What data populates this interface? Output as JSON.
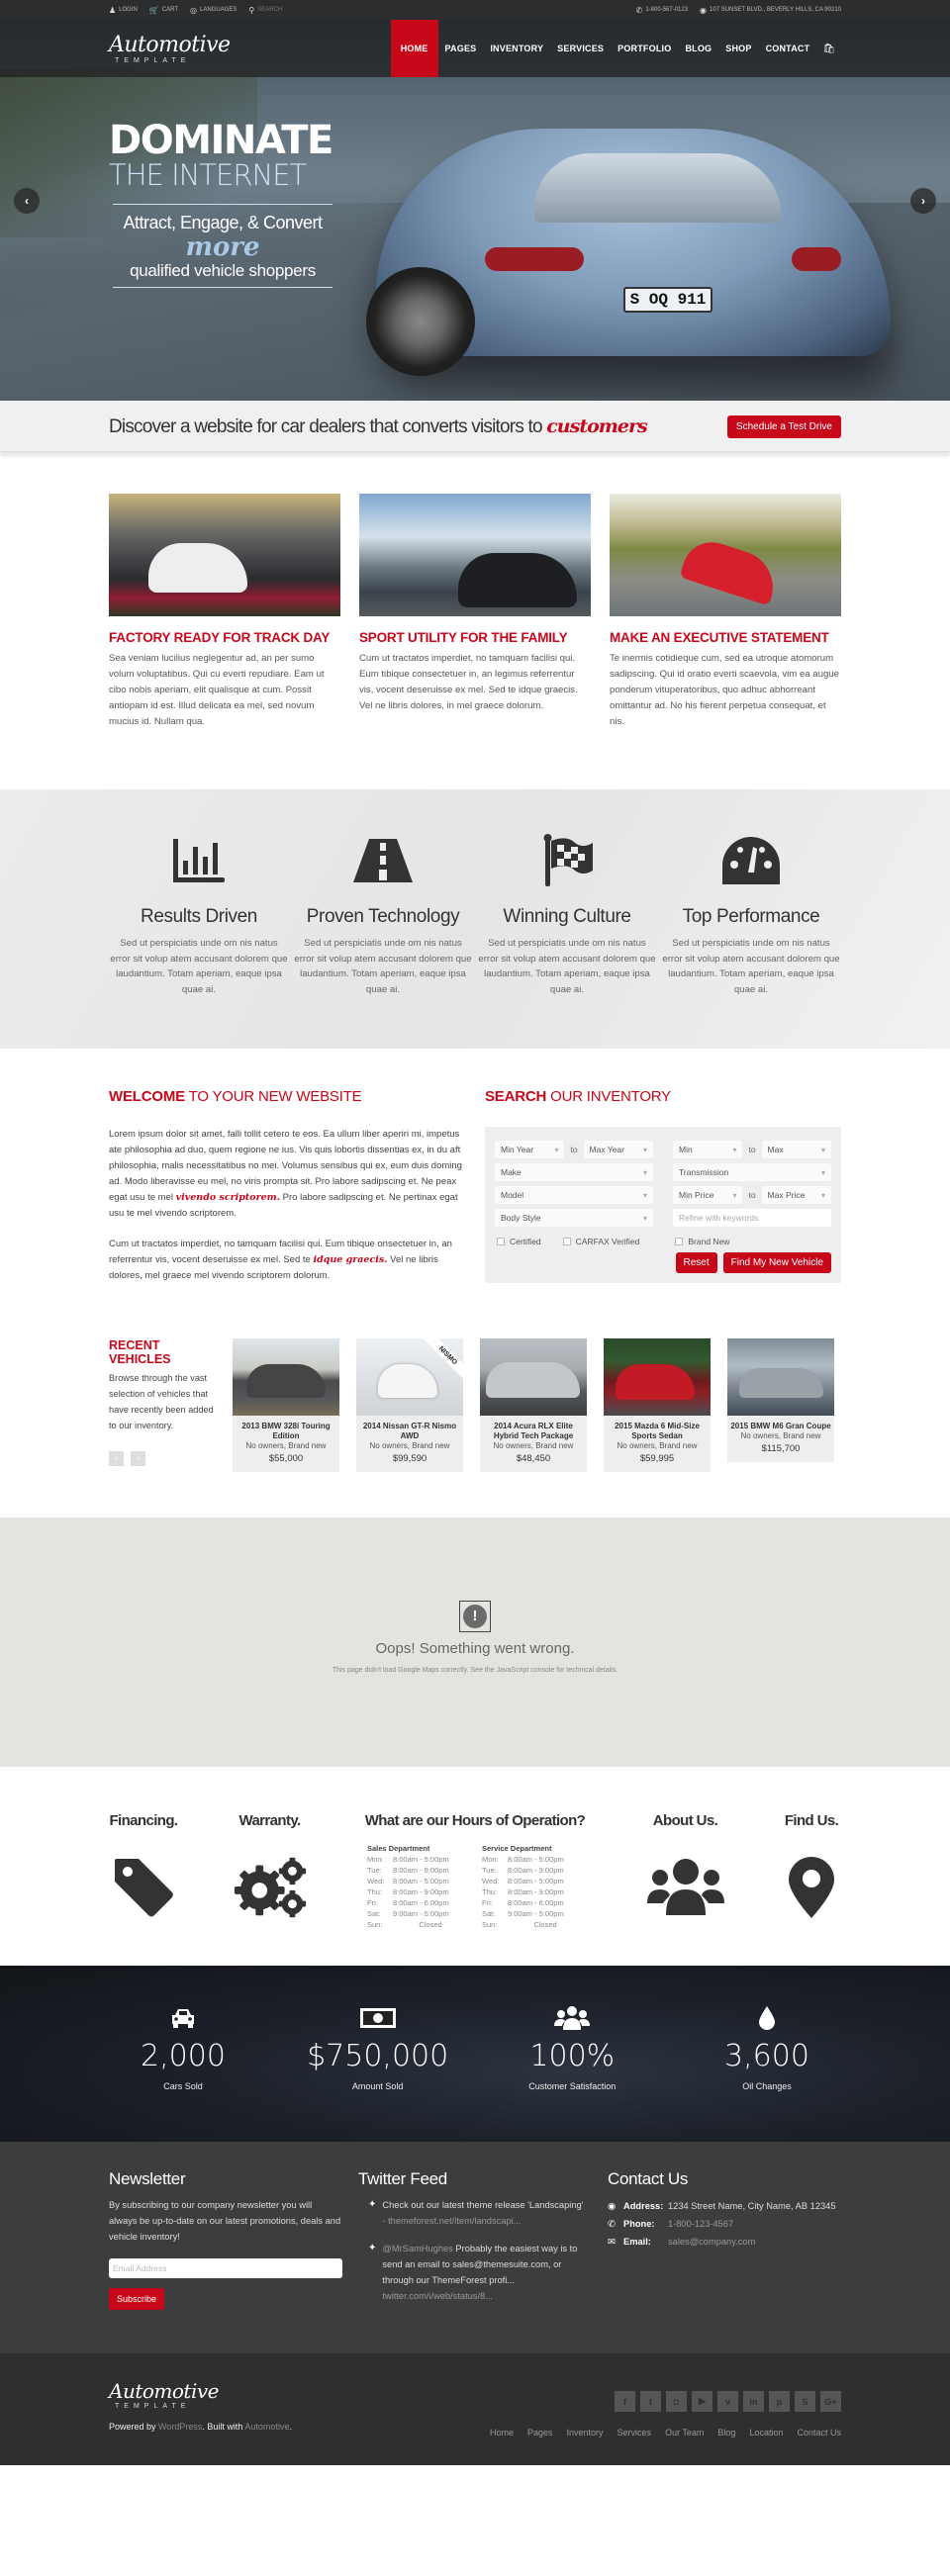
{
  "topbar": {
    "login": "Login",
    "cart": "Cart",
    "languages": "Languages",
    "search": "Search",
    "phone": "1-800-567-0123",
    "address": "107 Sunset Blvd., Beverly Hills, CA 90210"
  },
  "logo": {
    "script": "Automotive",
    "sub": "TEMPLATE"
  },
  "nav": {
    "items": [
      {
        "label": "HOME",
        "active": true
      },
      {
        "label": "PAGES"
      },
      {
        "label": "INVENTORY"
      },
      {
        "label": "SERVICES"
      },
      {
        "label": "PORTFOLIO"
      },
      {
        "label": "BLOG"
      },
      {
        "label": "SHOP"
      },
      {
        "label": "CONTACT"
      }
    ]
  },
  "hero": {
    "line1": "DOMINATE",
    "line2": "THE INTERNET",
    "line3": "Attract, Engage, & Convert",
    "line4": "more",
    "line5": "qualified vehicle shoppers",
    "plate": "S OQ 911",
    "prev": "‹",
    "next": "›"
  },
  "banner": {
    "text": "Discover a website for car dealers that converts visitors to ",
    "highlight": "customers",
    "button": "Schedule a Test Drive"
  },
  "features": [
    {
      "title": "FACTORY READY FOR TRACK DAY",
      "text": "Sea veniam lucilius neglegentur ad, an per sumo volum voluptatibus. Qui cu everti repudiare. Eam ut cibo nobis aperiam, elit qualisque at cum. Possit antiopam id est. Illud delicata ea mel, sed novum mucius id. Nullam qua."
    },
    {
      "title": "SPORT UTILITY FOR THE FAMILY",
      "text": "Cum ut tractatos imperdiet, no tamquam facilisi qui. Eum tibique consectetuer in, an legimus referrentur vis, vocent deseruisse ex mel. Sed te idque graecis. Vel ne libris dolores, in mel graece dolorum."
    },
    {
      "title": "MAKE AN EXECUTIVE STATEMENT",
      "text": "Te inermis cotidieque cum, sed ea utroque atomorum sadipscing. Qui id oratio everti scaevola, vim ea augue ponderum vituperatoribus, quo adhuc abhorreant omittantur ad. No his fierent perpetua consequat, et nis."
    }
  ],
  "strip": [
    {
      "icon": "bar-chart-icon",
      "title": "Results Driven",
      "text": "Sed ut perspiciatis unde om nis natus error sit volup atem accusant dolorem que laudantium. Totam aperiam, eaque ipsa quae ai."
    },
    {
      "icon": "road-icon",
      "title": "Proven Technology",
      "text": "Sed ut perspiciatis unde om nis natus error sit volup atem accusant dolorem que laudantium. Totam aperiam, eaque ipsa quae ai."
    },
    {
      "icon": "checkered-flag-icon",
      "title": "Winning Culture",
      "text": "Sed ut perspiciatis unde om nis natus error sit volup atem accusant dolorem que laudantium. Totam aperiam, eaque ipsa quae ai."
    },
    {
      "icon": "speedometer-icon",
      "title": "Top Performance",
      "text": "Sed ut perspiciatis unde om nis natus error sit volup atem accusant dolorem que laudantium. Totam aperiam, eaque ipsa quae ai."
    }
  ],
  "welcome": {
    "title_bold": "WELCOME",
    "title_rest": " TO YOUR NEW WEBSITE",
    "p1_a": "Lorem ipsum dolor sit amet, falli tollit cetero te eos. Ea ullum liber aperiri mi, impetus ate philosophia ad duo, quem regione ne ius. Vis quis lobortis dissentias ex, in du aft philosophia, malis necessitatibus no mei. Volumus sensibus qui ex, eum duis doming ad. Modo liberavisse eu mel, no viris prompta sit. Pro labore sadipscing et. Ne peax egat usu te mel ",
    "p1_script": "vivendo scriptorem.",
    "p1_b": " Pro labore sadipscing et. Ne pertinax egat usu te mel vivendo scriptorem.",
    "p2_a": "Cum ut tractatos imperdiet, no tamquam facilisi qui. Eum tibique onsectetuer in, an referrentur vis, vocent deseruisse ex mel. Sed te ",
    "p2_script": "idque graecis.",
    "p2_b": " Vel ne libris dolores, mel graece mel vivendo scriptorem dolorum."
  },
  "search": {
    "title_bold": "SEARCH",
    "title_rest": " OUR INVENTORY",
    "min_year": "Min Year",
    "max_year": "Max Year",
    "min": "Min",
    "max": "Max",
    "to": "to",
    "make": "Make",
    "transmission": "Transmission",
    "model": "Model",
    "min_price": "Min Price",
    "max_price": "Max Price",
    "body_style": "Body Style",
    "keywords_placeholder": "Refine with keywords",
    "checks": [
      "Certified",
      "CARFAX Verified",
      "Brand New"
    ],
    "reset": "Reset",
    "submit": "Find My New Vehicle"
  },
  "recent": {
    "title": "RECENT VEHICLES",
    "text": "Browse through the vast selection of vehicles that have recently been added to our inventory.",
    "prev": "‹",
    "next": "›",
    "vehicles": [
      {
        "title": "2013 BMW 328i Touring Edition",
        "sub": "No owners, Brand new",
        "price": "$55,000"
      },
      {
        "title": "2014 Nissan GT-R Nismo AWD",
        "sub": "No owners, Brand new",
        "price": "$99,590",
        "badge": "NISMO"
      },
      {
        "title": "2014 Acura RLX Elite Hybrid Tech Package",
        "sub": "No owners, Brand new",
        "price": "$48,450"
      },
      {
        "title": "2015 Mazda 6 Mid-Size Sports Sedan",
        "sub": "No owners, Brand new",
        "price": "$59,995"
      },
      {
        "title": "2015 BMW M6 Gran Coupe",
        "sub": "No owners, Brand new",
        "price": "$115,700"
      }
    ]
  },
  "map": {
    "icon": "!",
    "title": "Oops! Something went wrong.",
    "text": "This page didn't load Google Maps correctly. See the JavaScript console for technical details."
  },
  "info": {
    "financing": "Financing.",
    "warranty": "Warranty.",
    "hours_title": "What are our Hours of Operation?",
    "about": "About Us.",
    "find": "Find Us.",
    "sales_title": "Sales Department",
    "service_title": "Service Department",
    "sales": [
      [
        "Mon:",
        "8:00am - 5:00pm"
      ],
      [
        "Tue:",
        "8:00am - 9:00pm"
      ],
      [
        "Wed:",
        "8:00am - 5:00pm"
      ],
      [
        "Thu:",
        "8:00am - 9:00pm"
      ],
      [
        "Fri:",
        "8:00am - 6:00pm"
      ],
      [
        "Sat:",
        "9:00am - 5:00pm"
      ],
      [
        "Sun:",
        "Closed"
      ]
    ],
    "service": [
      [
        "Mon:",
        "8:00am - 5:00pm"
      ],
      [
        "Tue:",
        "8:00am - 9:00pm"
      ],
      [
        "Wed:",
        "8:00am - 5:00pm"
      ],
      [
        "Thu:",
        "8:00am - 9:00pm"
      ],
      [
        "Fri:",
        "8:00am - 6:00pm"
      ],
      [
        "Sat:",
        "9:00am - 5:00pm"
      ],
      [
        "Sun:",
        "Closed"
      ]
    ]
  },
  "stats": [
    {
      "icon": "car-icon",
      "value": "2,000",
      "label": "Cars Sold"
    },
    {
      "icon": "money-icon",
      "value": "$750,000",
      "label": "Amount Sold"
    },
    {
      "icon": "users-icon",
      "value": "100%",
      "label": "Customer Satisfaction"
    },
    {
      "icon": "oil-drop-icon",
      "value": "3,600",
      "label": "Oil Changes"
    }
  ],
  "footer": {
    "newsletter_title": "Newsletter",
    "newsletter_text": "By subscribing to our company newsletter you will always be up-to-date on our latest promotions, deals and vehicle inventory!",
    "email_placeholder": "Email Address",
    "subscribe": "Subscribe",
    "twitter_title": "Twitter Feed",
    "tweet1_text": "Check out our latest theme release 'Landscaping'",
    "tweet1_link": "- themeforest.net/item/landscapi...",
    "tweet2_user": "@MrSamHughes",
    "tweet2_text": " Probably the easiest way is to send an email to sales@themesuite.com, or through our ThemeForest profi... ",
    "tweet2_link": "twitter.com/i/web/status/8...",
    "contact_title": "Contact Us",
    "address_label": "Address:",
    "address": "1234 Street Name, City Name, AB 12345",
    "phone_label": "Phone:",
    "phone": "1-800-123-4567",
    "email_label": "Email:",
    "email": "sales@company.com",
    "powered_a": "Powered by ",
    "powered_wp": "WordPress",
    "powered_b": ". Built with ",
    "powered_auto": "Automotive",
    "powered_c": ".",
    "social": [
      {
        "name": "facebook-icon",
        "glyph": "f"
      },
      {
        "name": "twitter-icon",
        "glyph": "t"
      },
      {
        "name": "instagram-icon",
        "glyph": "◘"
      },
      {
        "name": "youtube-icon",
        "glyph": "▶"
      },
      {
        "name": "vimeo-icon",
        "glyph": "v"
      },
      {
        "name": "linkedin-icon",
        "glyph": "in"
      },
      {
        "name": "pinterest-icon",
        "glyph": "p"
      },
      {
        "name": "skype-icon",
        "glyph": "S"
      },
      {
        "name": "google-plus-icon",
        "glyph": "G+"
      }
    ],
    "links": [
      "Home",
      "Pages",
      "Inventory",
      "Services",
      "Our Team",
      "Blog",
      "Location",
      "Contact Us"
    ]
  },
  "colors": {
    "accent": "#c7081b",
    "dark": "#3d3d3d",
    "darker": "#2f2f2f"
  }
}
